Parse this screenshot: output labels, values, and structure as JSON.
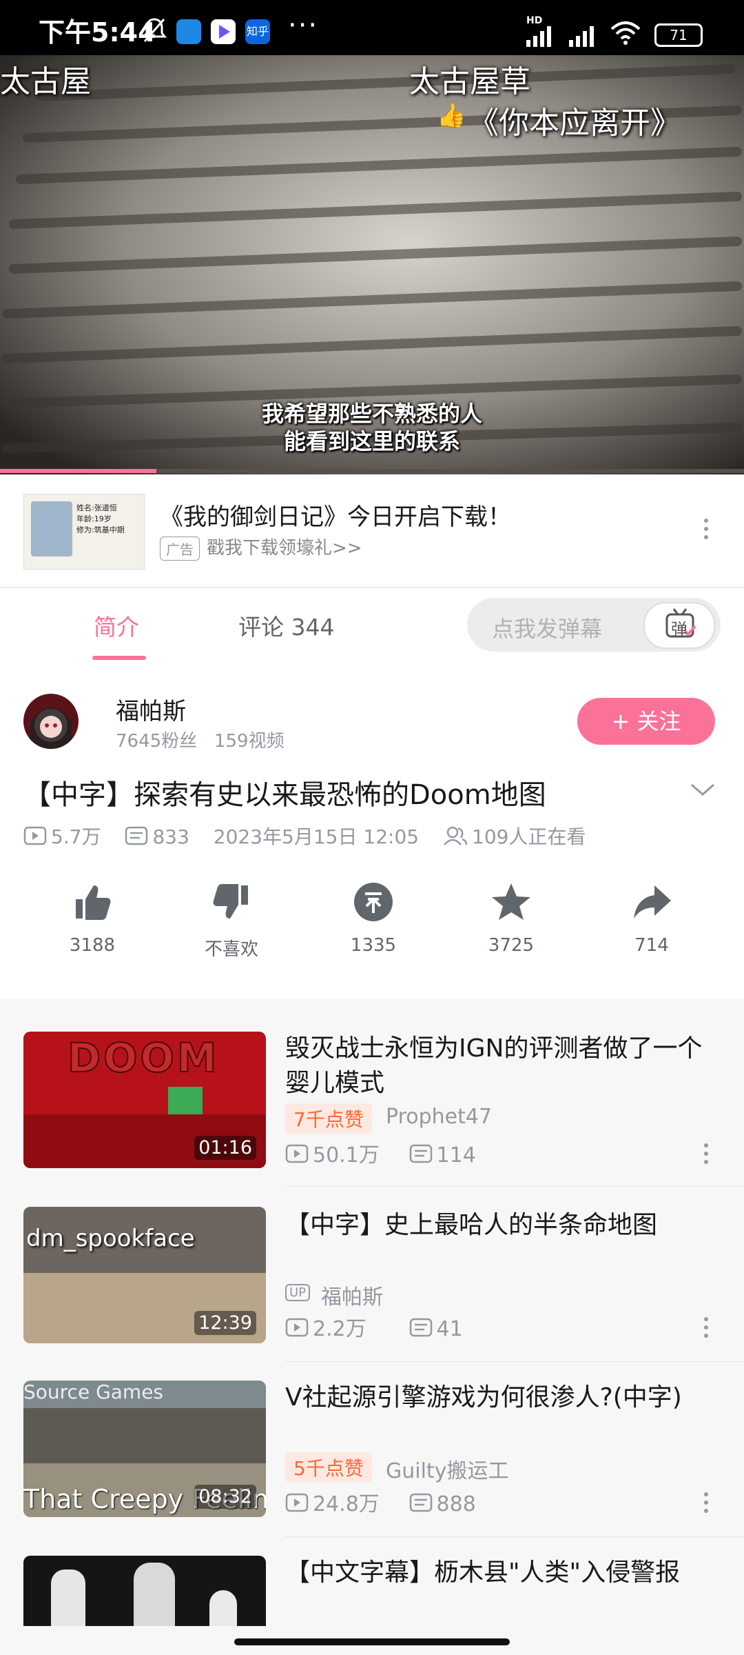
{
  "status_bar": {
    "time": "下午5:44",
    "network": "HD",
    "battery": "71"
  },
  "video": {
    "danmaku": [
      "太古屋",
      "太古屋草",
      "《你本应离开》"
    ],
    "subtitle_line1": "我希望那些不熟悉的人",
    "subtitle_line2": "能看到这里的联系",
    "progress": 0.21
  },
  "ad": {
    "title": "《我的御剑日记》今日开启下载！",
    "tag": "广告",
    "subtitle": "戳我下载领壕礼>>",
    "thumb_text": [
      "姓名:张道恒",
      "年龄:19岁",
      "修为:筑基中期"
    ]
  },
  "tabs": {
    "intro": "简介",
    "comments_label": "评论",
    "comments_count": "344",
    "danmaku_placeholder": "点我发弹幕",
    "danmaku_btn": "弹"
  },
  "uploader": {
    "name": "福帕斯",
    "fans": "7645粉丝",
    "videos": "159视频",
    "follow": "+ 关注"
  },
  "video_info": {
    "title": "【中字】探索有史以来最恐怖的Doom地图",
    "views": "5.7万",
    "danmaku_count": "833",
    "date": "2023年5月15日 12:05",
    "watching": "109人正在看"
  },
  "actions": {
    "like": "3188",
    "dislike": "不喜欢",
    "coin": "1335",
    "favorite": "3725",
    "share": "714"
  },
  "related": [
    {
      "title": "毁灭战士永恒为IGN的评测者做了一个婴儿模式",
      "badge": "7千点赞",
      "up": "Prophet47",
      "views": "50.1万",
      "danmaku": "114",
      "duration": "01:16",
      "thumb_text": "DOOM"
    },
    {
      "title": "【中字】史上最哈人的半条命地图",
      "badge": "",
      "up": "福帕斯",
      "views": "2.2万",
      "danmaku": "41",
      "duration": "12:39",
      "thumb_text": "dm_spookface"
    },
    {
      "title": "V社起源引擎游戏为何很渗人?(中字)",
      "badge": "5千点赞",
      "up": "Guilty搬运工",
      "views": "24.8万",
      "danmaku": "888",
      "duration": "08:32",
      "thumb_text": "Source Games",
      "thumb_text2": "That Creepy Feelin"
    },
    {
      "title": "【中文字幕】枥木县\"人类\"入侵警报",
      "badge": "",
      "up": "",
      "views": "",
      "danmaku": "",
      "duration": "",
      "thumb_text": ""
    }
  ],
  "colors": {
    "accent": "#fb7299",
    "badge_text": "#ff6633",
    "gray_text": "#9499a0"
  }
}
